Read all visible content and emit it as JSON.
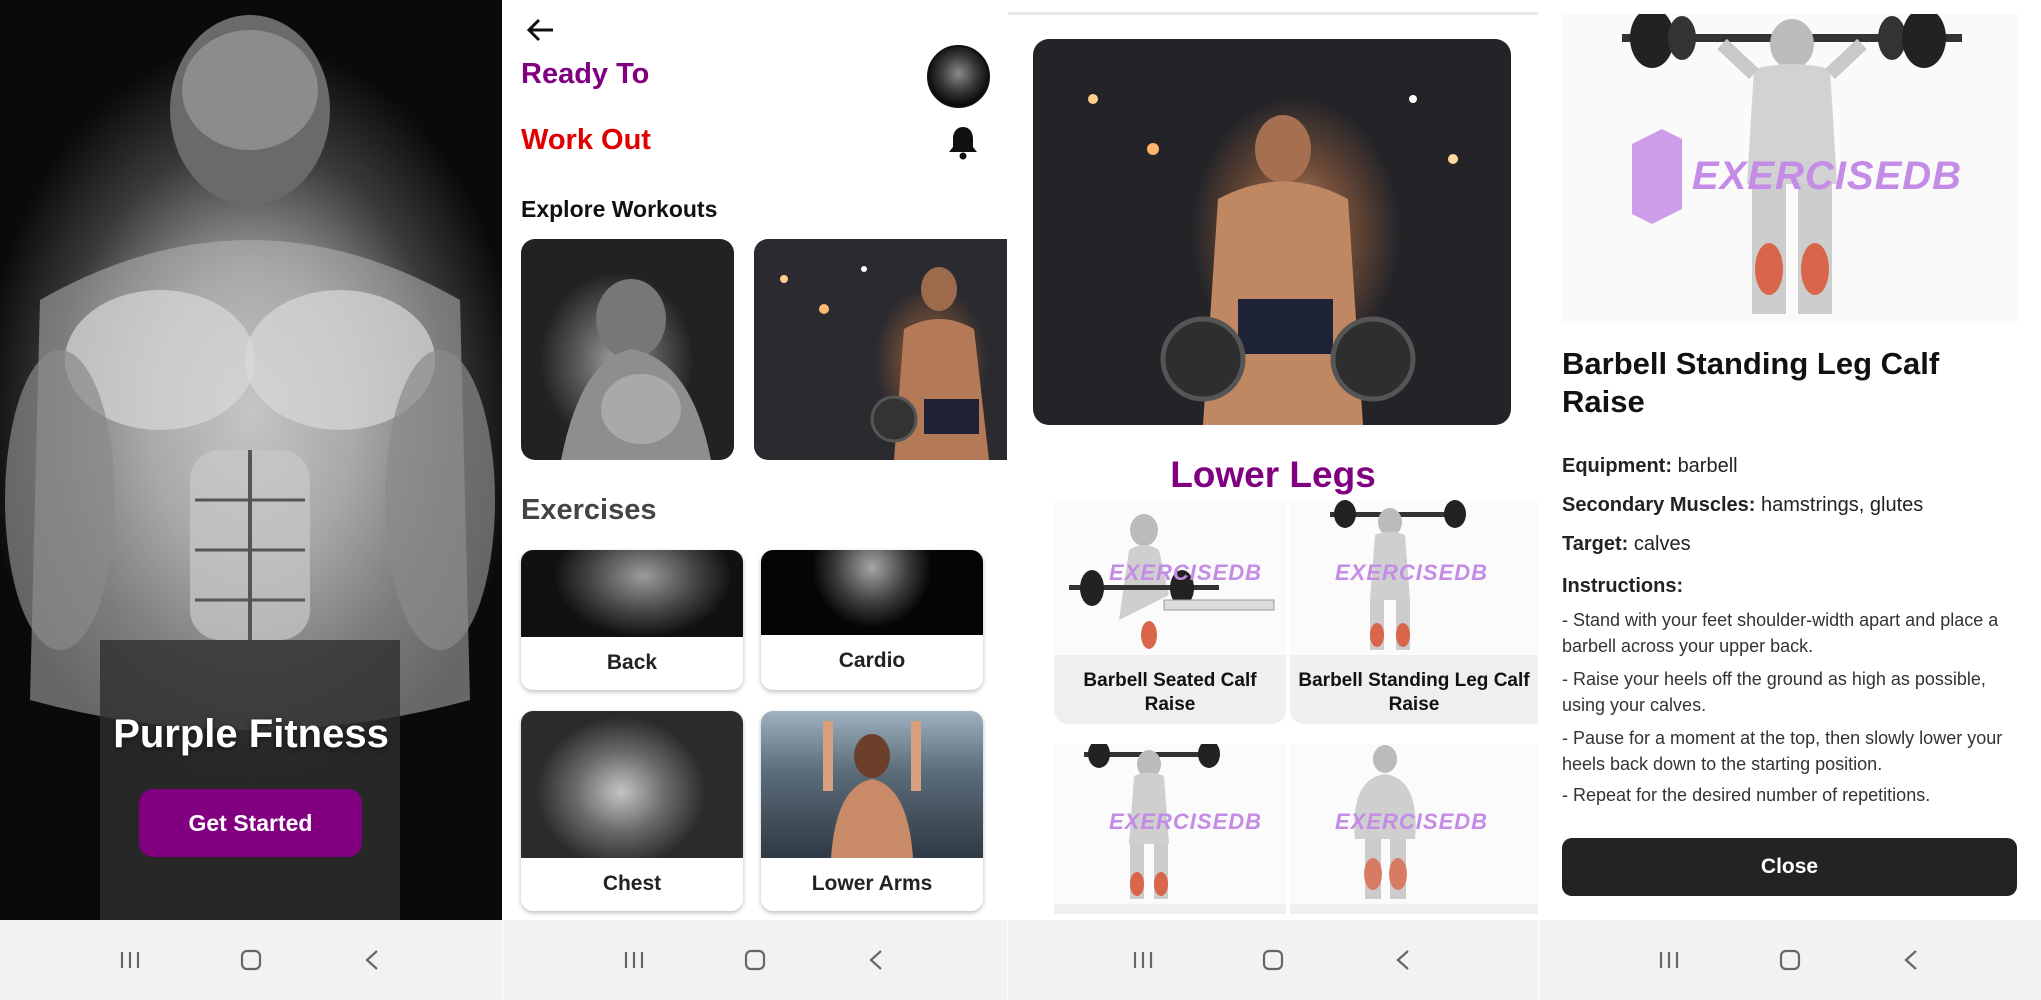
{
  "screen1": {
    "app_title": "Purple Fitness",
    "cta_label": "Get Started",
    "accent": "#800080"
  },
  "screen2": {
    "heading_line1": "Ready To",
    "heading_line2": "Work Out",
    "explore_title": "Explore Workouts",
    "exercises_title": "Exercises",
    "categories": [
      "Back",
      "Cardio",
      "Chest",
      "Lower Arms"
    ],
    "colors": {
      "purple": "#800080",
      "red": "#e00000"
    }
  },
  "screen3": {
    "section_title": "Lower Legs",
    "exercises": [
      {
        "name": "Barbell Seated Calf Raise"
      },
      {
        "name": "Barbell Standing Leg Calf Raise"
      },
      {
        "name": ""
      },
      {
        "name": ""
      }
    ],
    "watermark": "EXERCISEDB"
  },
  "screen4": {
    "watermark": "EXERCISEDB",
    "title": "Barbell Standing Leg Calf Raise",
    "equipment_label": "Equipment:",
    "equipment": "barbell",
    "secondary_label": "Secondary Muscles:",
    "secondary": "hamstrings, glutes",
    "target_label": "Target:",
    "target": "calves",
    "instructions_label": "Instructions:",
    "instructions": [
      "- Stand with your feet shoulder-width apart and place a barbell across your upper back.",
      "- Raise your heels off the ground as high as possible, using your calves.",
      "- Pause for a moment at the top, then slowly lower your heels back down to the starting position.",
      "- Repeat for the desired number of repetitions."
    ],
    "close_label": "Close"
  },
  "navbar": {
    "icons": [
      "recent-apps-icon",
      "home-icon",
      "back-icon"
    ]
  }
}
